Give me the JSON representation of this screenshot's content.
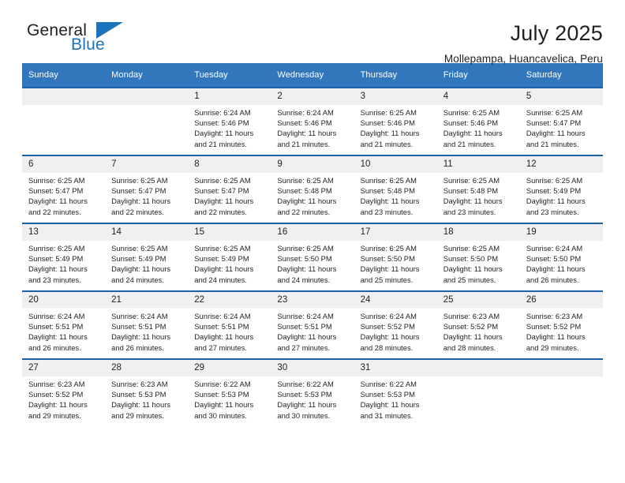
{
  "brand": {
    "name_top": "General",
    "name_bottom": "Blue",
    "accent_color": "#1b74bb"
  },
  "header": {
    "title": "July 2025",
    "subtitle": "Mollepampa, Huancavelica, Peru"
  },
  "calendar": {
    "header_bg": "#3277bc",
    "row_separator_color": "#1b61a8",
    "daynum_bg": "#f0f0f0",
    "weekday_headers": [
      "Sunday",
      "Monday",
      "Tuesday",
      "Wednesday",
      "Thursday",
      "Friday",
      "Saturday"
    ],
    "weeks": [
      [
        {
          "day": "",
          "lines": []
        },
        {
          "day": "",
          "lines": []
        },
        {
          "day": "1",
          "lines": [
            "Sunrise: 6:24 AM",
            "Sunset: 5:46 PM",
            "Daylight: 11 hours",
            "and 21 minutes."
          ]
        },
        {
          "day": "2",
          "lines": [
            "Sunrise: 6:24 AM",
            "Sunset: 5:46 PM",
            "Daylight: 11 hours",
            "and 21 minutes."
          ]
        },
        {
          "day": "3",
          "lines": [
            "Sunrise: 6:25 AM",
            "Sunset: 5:46 PM",
            "Daylight: 11 hours",
            "and 21 minutes."
          ]
        },
        {
          "day": "4",
          "lines": [
            "Sunrise: 6:25 AM",
            "Sunset: 5:46 PM",
            "Daylight: 11 hours",
            "and 21 minutes."
          ]
        },
        {
          "day": "5",
          "lines": [
            "Sunrise: 6:25 AM",
            "Sunset: 5:47 PM",
            "Daylight: 11 hours",
            "and 21 minutes."
          ]
        }
      ],
      [
        {
          "day": "6",
          "lines": [
            "Sunrise: 6:25 AM",
            "Sunset: 5:47 PM",
            "Daylight: 11 hours",
            "and 22 minutes."
          ]
        },
        {
          "day": "7",
          "lines": [
            "Sunrise: 6:25 AM",
            "Sunset: 5:47 PM",
            "Daylight: 11 hours",
            "and 22 minutes."
          ]
        },
        {
          "day": "8",
          "lines": [
            "Sunrise: 6:25 AM",
            "Sunset: 5:47 PM",
            "Daylight: 11 hours",
            "and 22 minutes."
          ]
        },
        {
          "day": "9",
          "lines": [
            "Sunrise: 6:25 AM",
            "Sunset: 5:48 PM",
            "Daylight: 11 hours",
            "and 22 minutes."
          ]
        },
        {
          "day": "10",
          "lines": [
            "Sunrise: 6:25 AM",
            "Sunset: 5:48 PM",
            "Daylight: 11 hours",
            "and 23 minutes."
          ]
        },
        {
          "day": "11",
          "lines": [
            "Sunrise: 6:25 AM",
            "Sunset: 5:48 PM",
            "Daylight: 11 hours",
            "and 23 minutes."
          ]
        },
        {
          "day": "12",
          "lines": [
            "Sunrise: 6:25 AM",
            "Sunset: 5:49 PM",
            "Daylight: 11 hours",
            "and 23 minutes."
          ]
        }
      ],
      [
        {
          "day": "13",
          "lines": [
            "Sunrise: 6:25 AM",
            "Sunset: 5:49 PM",
            "Daylight: 11 hours",
            "and 23 minutes."
          ]
        },
        {
          "day": "14",
          "lines": [
            "Sunrise: 6:25 AM",
            "Sunset: 5:49 PM",
            "Daylight: 11 hours",
            "and 24 minutes."
          ]
        },
        {
          "day": "15",
          "lines": [
            "Sunrise: 6:25 AM",
            "Sunset: 5:49 PM",
            "Daylight: 11 hours",
            "and 24 minutes."
          ]
        },
        {
          "day": "16",
          "lines": [
            "Sunrise: 6:25 AM",
            "Sunset: 5:50 PM",
            "Daylight: 11 hours",
            "and 24 minutes."
          ]
        },
        {
          "day": "17",
          "lines": [
            "Sunrise: 6:25 AM",
            "Sunset: 5:50 PM",
            "Daylight: 11 hours",
            "and 25 minutes."
          ]
        },
        {
          "day": "18",
          "lines": [
            "Sunrise: 6:25 AM",
            "Sunset: 5:50 PM",
            "Daylight: 11 hours",
            "and 25 minutes."
          ]
        },
        {
          "day": "19",
          "lines": [
            "Sunrise: 6:24 AM",
            "Sunset: 5:50 PM",
            "Daylight: 11 hours",
            "and 26 minutes."
          ]
        }
      ],
      [
        {
          "day": "20",
          "lines": [
            "Sunrise: 6:24 AM",
            "Sunset: 5:51 PM",
            "Daylight: 11 hours",
            "and 26 minutes."
          ]
        },
        {
          "day": "21",
          "lines": [
            "Sunrise: 6:24 AM",
            "Sunset: 5:51 PM",
            "Daylight: 11 hours",
            "and 26 minutes."
          ]
        },
        {
          "day": "22",
          "lines": [
            "Sunrise: 6:24 AM",
            "Sunset: 5:51 PM",
            "Daylight: 11 hours",
            "and 27 minutes."
          ]
        },
        {
          "day": "23",
          "lines": [
            "Sunrise: 6:24 AM",
            "Sunset: 5:51 PM",
            "Daylight: 11 hours",
            "and 27 minutes."
          ]
        },
        {
          "day": "24",
          "lines": [
            "Sunrise: 6:24 AM",
            "Sunset: 5:52 PM",
            "Daylight: 11 hours",
            "and 28 minutes."
          ]
        },
        {
          "day": "25",
          "lines": [
            "Sunrise: 6:23 AM",
            "Sunset: 5:52 PM",
            "Daylight: 11 hours",
            "and 28 minutes."
          ]
        },
        {
          "day": "26",
          "lines": [
            "Sunrise: 6:23 AM",
            "Sunset: 5:52 PM",
            "Daylight: 11 hours",
            "and 29 minutes."
          ]
        }
      ],
      [
        {
          "day": "27",
          "lines": [
            "Sunrise: 6:23 AM",
            "Sunset: 5:52 PM",
            "Daylight: 11 hours",
            "and 29 minutes."
          ]
        },
        {
          "day": "28",
          "lines": [
            "Sunrise: 6:23 AM",
            "Sunset: 5:53 PM",
            "Daylight: 11 hours",
            "and 29 minutes."
          ]
        },
        {
          "day": "29",
          "lines": [
            "Sunrise: 6:22 AM",
            "Sunset: 5:53 PM",
            "Daylight: 11 hours",
            "and 30 minutes."
          ]
        },
        {
          "day": "30",
          "lines": [
            "Sunrise: 6:22 AM",
            "Sunset: 5:53 PM",
            "Daylight: 11 hours",
            "and 30 minutes."
          ]
        },
        {
          "day": "31",
          "lines": [
            "Sunrise: 6:22 AM",
            "Sunset: 5:53 PM",
            "Daylight: 11 hours",
            "and 31 minutes."
          ]
        },
        {
          "day": "",
          "lines": []
        },
        {
          "day": "",
          "lines": []
        }
      ]
    ]
  }
}
